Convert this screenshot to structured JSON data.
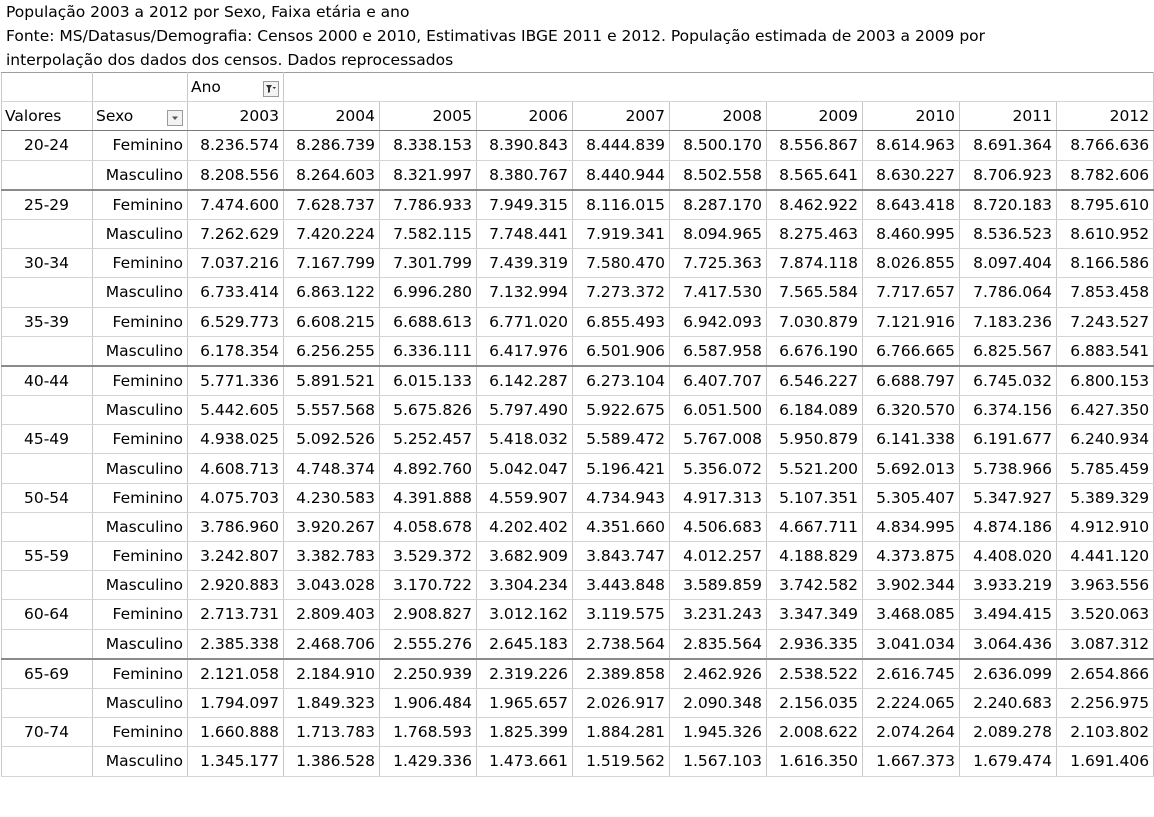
{
  "title_lines": [
    "População 2003 a 2012 por Sexo, Faixa etária e ano",
    "Fonte: MS/Datasus/Demografia: Censos 2000 e 2010, Estimativas IBGE 2011 e 2012. População estimada de 2003 a 2009 por",
    "interpolação dos dados dos censos. Dados reprocessados"
  ],
  "header": {
    "ano_label": "Ano",
    "valores_label": "Valores",
    "sexo_label": "Sexo",
    "years": [
      "2003",
      "2004",
      "2005",
      "2006",
      "2007",
      "2008",
      "2009",
      "2010",
      "2011",
      "2012"
    ]
  },
  "icons": {
    "ano_filter": "filter-active-icon",
    "sexo_filter": "dropdown-arrow-icon"
  },
  "groups": [
    {
      "age": "20-24",
      "rows": [
        {
          "sex": "Feminino",
          "values": [
            "8.236.574",
            "8.286.739",
            "8.338.153",
            "8.390.843",
            "8.444.839",
            "8.500.170",
            "8.556.867",
            "8.614.963",
            "8.691.364",
            "8.766.636"
          ]
        },
        {
          "sex": "Masculino",
          "values": [
            "8.208.556",
            "8.264.603",
            "8.321.997",
            "8.380.767",
            "8.440.944",
            "8.502.558",
            "8.565.641",
            "8.630.227",
            "8.706.923",
            "8.782.606"
          ]
        }
      ]
    },
    {
      "age": "25-29",
      "rows": [
        {
          "sex": "Feminino",
          "values": [
            "7.474.600",
            "7.628.737",
            "7.786.933",
            "7.949.315",
            "8.116.015",
            "8.287.170",
            "8.462.922",
            "8.643.418",
            "8.720.183",
            "8.795.610"
          ]
        },
        {
          "sex": "Masculino",
          "values": [
            "7.262.629",
            "7.420.224",
            "7.582.115",
            "7.748.441",
            "7.919.341",
            "8.094.965",
            "8.275.463",
            "8.460.995",
            "8.536.523",
            "8.610.952"
          ]
        }
      ]
    },
    {
      "age": "30-34",
      "rows": [
        {
          "sex": "Feminino",
          "values": [
            "7.037.216",
            "7.167.799",
            "7.301.799",
            "7.439.319",
            "7.580.470",
            "7.725.363",
            "7.874.118",
            "8.026.855",
            "8.097.404",
            "8.166.586"
          ]
        },
        {
          "sex": "Masculino",
          "values": [
            "6.733.414",
            "6.863.122",
            "6.996.280",
            "7.132.994",
            "7.273.372",
            "7.417.530",
            "7.565.584",
            "7.717.657",
            "7.786.064",
            "7.853.458"
          ]
        }
      ]
    },
    {
      "age": "35-39",
      "rows": [
        {
          "sex": "Feminino",
          "values": [
            "6.529.773",
            "6.608.215",
            "6.688.613",
            "6.771.020",
            "6.855.493",
            "6.942.093",
            "7.030.879",
            "7.121.916",
            "7.183.236",
            "7.243.527"
          ]
        },
        {
          "sex": "Masculino",
          "values": [
            "6.178.354",
            "6.256.255",
            "6.336.111",
            "6.417.976",
            "6.501.906",
            "6.587.958",
            "6.676.190",
            "6.766.665",
            "6.825.567",
            "6.883.541"
          ]
        }
      ]
    },
    {
      "age": "40-44",
      "rows": [
        {
          "sex": "Feminino",
          "values": [
            "5.771.336",
            "5.891.521",
            "6.015.133",
            "6.142.287",
            "6.273.104",
            "6.407.707",
            "6.546.227",
            "6.688.797",
            "6.745.032",
            "6.800.153"
          ]
        },
        {
          "sex": "Masculino",
          "values": [
            "5.442.605",
            "5.557.568",
            "5.675.826",
            "5.797.490",
            "5.922.675",
            "6.051.500",
            "6.184.089",
            "6.320.570",
            "6.374.156",
            "6.427.350"
          ]
        }
      ]
    },
    {
      "age": "45-49",
      "rows": [
        {
          "sex": "Feminino",
          "values": [
            "4.938.025",
            "5.092.526",
            "5.252.457",
            "5.418.032",
            "5.589.472",
            "5.767.008",
            "5.950.879",
            "6.141.338",
            "6.191.677",
            "6.240.934"
          ]
        },
        {
          "sex": "Masculino",
          "values": [
            "4.608.713",
            "4.748.374",
            "4.892.760",
            "5.042.047",
            "5.196.421",
            "5.356.072",
            "5.521.200",
            "5.692.013",
            "5.738.966",
            "5.785.459"
          ]
        }
      ]
    },
    {
      "age": "50-54",
      "rows": [
        {
          "sex": "Feminino",
          "values": [
            "4.075.703",
            "4.230.583",
            "4.391.888",
            "4.559.907",
            "4.734.943",
            "4.917.313",
            "5.107.351",
            "5.305.407",
            "5.347.927",
            "5.389.329"
          ]
        },
        {
          "sex": "Masculino",
          "values": [
            "3.786.960",
            "3.920.267",
            "4.058.678",
            "4.202.402",
            "4.351.660",
            "4.506.683",
            "4.667.711",
            "4.834.995",
            "4.874.186",
            "4.912.910"
          ]
        }
      ]
    },
    {
      "age": "55-59",
      "rows": [
        {
          "sex": "Feminino",
          "values": [
            "3.242.807",
            "3.382.783",
            "3.529.372",
            "3.682.909",
            "3.843.747",
            "4.012.257",
            "4.188.829",
            "4.373.875",
            "4.408.020",
            "4.441.120"
          ]
        },
        {
          "sex": "Masculino",
          "values": [
            "2.920.883",
            "3.043.028",
            "3.170.722",
            "3.304.234",
            "3.443.848",
            "3.589.859",
            "3.742.582",
            "3.902.344",
            "3.933.219",
            "3.963.556"
          ]
        }
      ]
    },
    {
      "age": "60-64",
      "rows": [
        {
          "sex": "Feminino",
          "values": [
            "2.713.731",
            "2.809.403",
            "2.908.827",
            "3.012.162",
            "3.119.575",
            "3.231.243",
            "3.347.349",
            "3.468.085",
            "3.494.415",
            "3.520.063"
          ]
        },
        {
          "sex": "Masculino",
          "values": [
            "2.385.338",
            "2.468.706",
            "2.555.276",
            "2.645.183",
            "2.738.564",
            "2.835.564",
            "2.936.335",
            "3.041.034",
            "3.064.436",
            "3.087.312"
          ]
        }
      ]
    },
    {
      "age": "65-69",
      "rows": [
        {
          "sex": "Feminino",
          "values": [
            "2.121.058",
            "2.184.910",
            "2.250.939",
            "2.319.226",
            "2.389.858",
            "2.462.926",
            "2.538.522",
            "2.616.745",
            "2.636.099",
            "2.654.866"
          ]
        },
        {
          "sex": "Masculino",
          "values": [
            "1.794.097",
            "1.849.323",
            "1.906.484",
            "1.965.657",
            "2.026.917",
            "2.090.348",
            "2.156.035",
            "2.224.065",
            "2.240.683",
            "2.256.975"
          ]
        }
      ]
    },
    {
      "age": "70-74",
      "rows": [
        {
          "sex": "Feminino",
          "values": [
            "1.660.888",
            "1.713.783",
            "1.768.593",
            "1.825.399",
            "1.884.281",
            "1.945.326",
            "2.008.622",
            "2.074.264",
            "2.089.278",
            "2.103.802"
          ]
        },
        {
          "sex": "Masculino",
          "values": [
            "1.345.177",
            "1.386.528",
            "1.429.336",
            "1.473.661",
            "1.519.562",
            "1.567.103",
            "1.616.350",
            "1.667.373",
            "1.679.474",
            "1.691.406"
          ]
        }
      ]
    }
  ]
}
